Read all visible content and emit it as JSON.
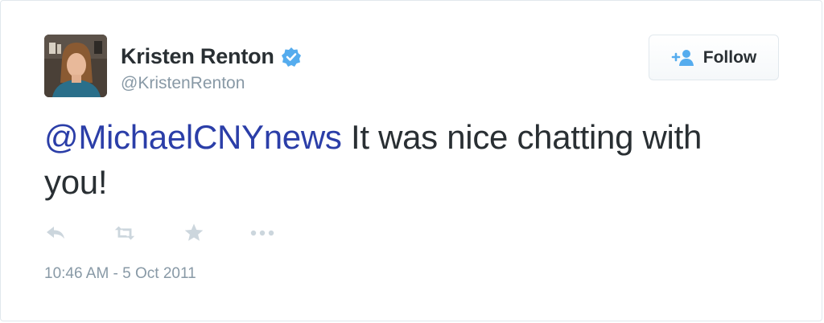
{
  "author": {
    "name": "Kristen Renton",
    "handle": "@KristenRenton",
    "verified": true,
    "avatar_icon": "profile-photo"
  },
  "follow_button": {
    "label": "Follow",
    "icon": "add-user-icon"
  },
  "tweet": {
    "mention": "@MichaelCNYnews",
    "text": " It was nice chatting with you!"
  },
  "actions": [
    {
      "name": "reply",
      "icon": "reply-icon"
    },
    {
      "name": "retweet",
      "icon": "retweet-icon"
    },
    {
      "name": "favorite",
      "icon": "star-icon"
    },
    {
      "name": "more",
      "icon": "more-icon"
    }
  ],
  "timestamp": "10:46 AM - 5 Oct 2011",
  "colors": {
    "text": "#292f33",
    "secondary": "#8899a6",
    "mention": "#2b3ea8",
    "verified": "#55acee",
    "icon_gray": "#ccd6dd"
  }
}
